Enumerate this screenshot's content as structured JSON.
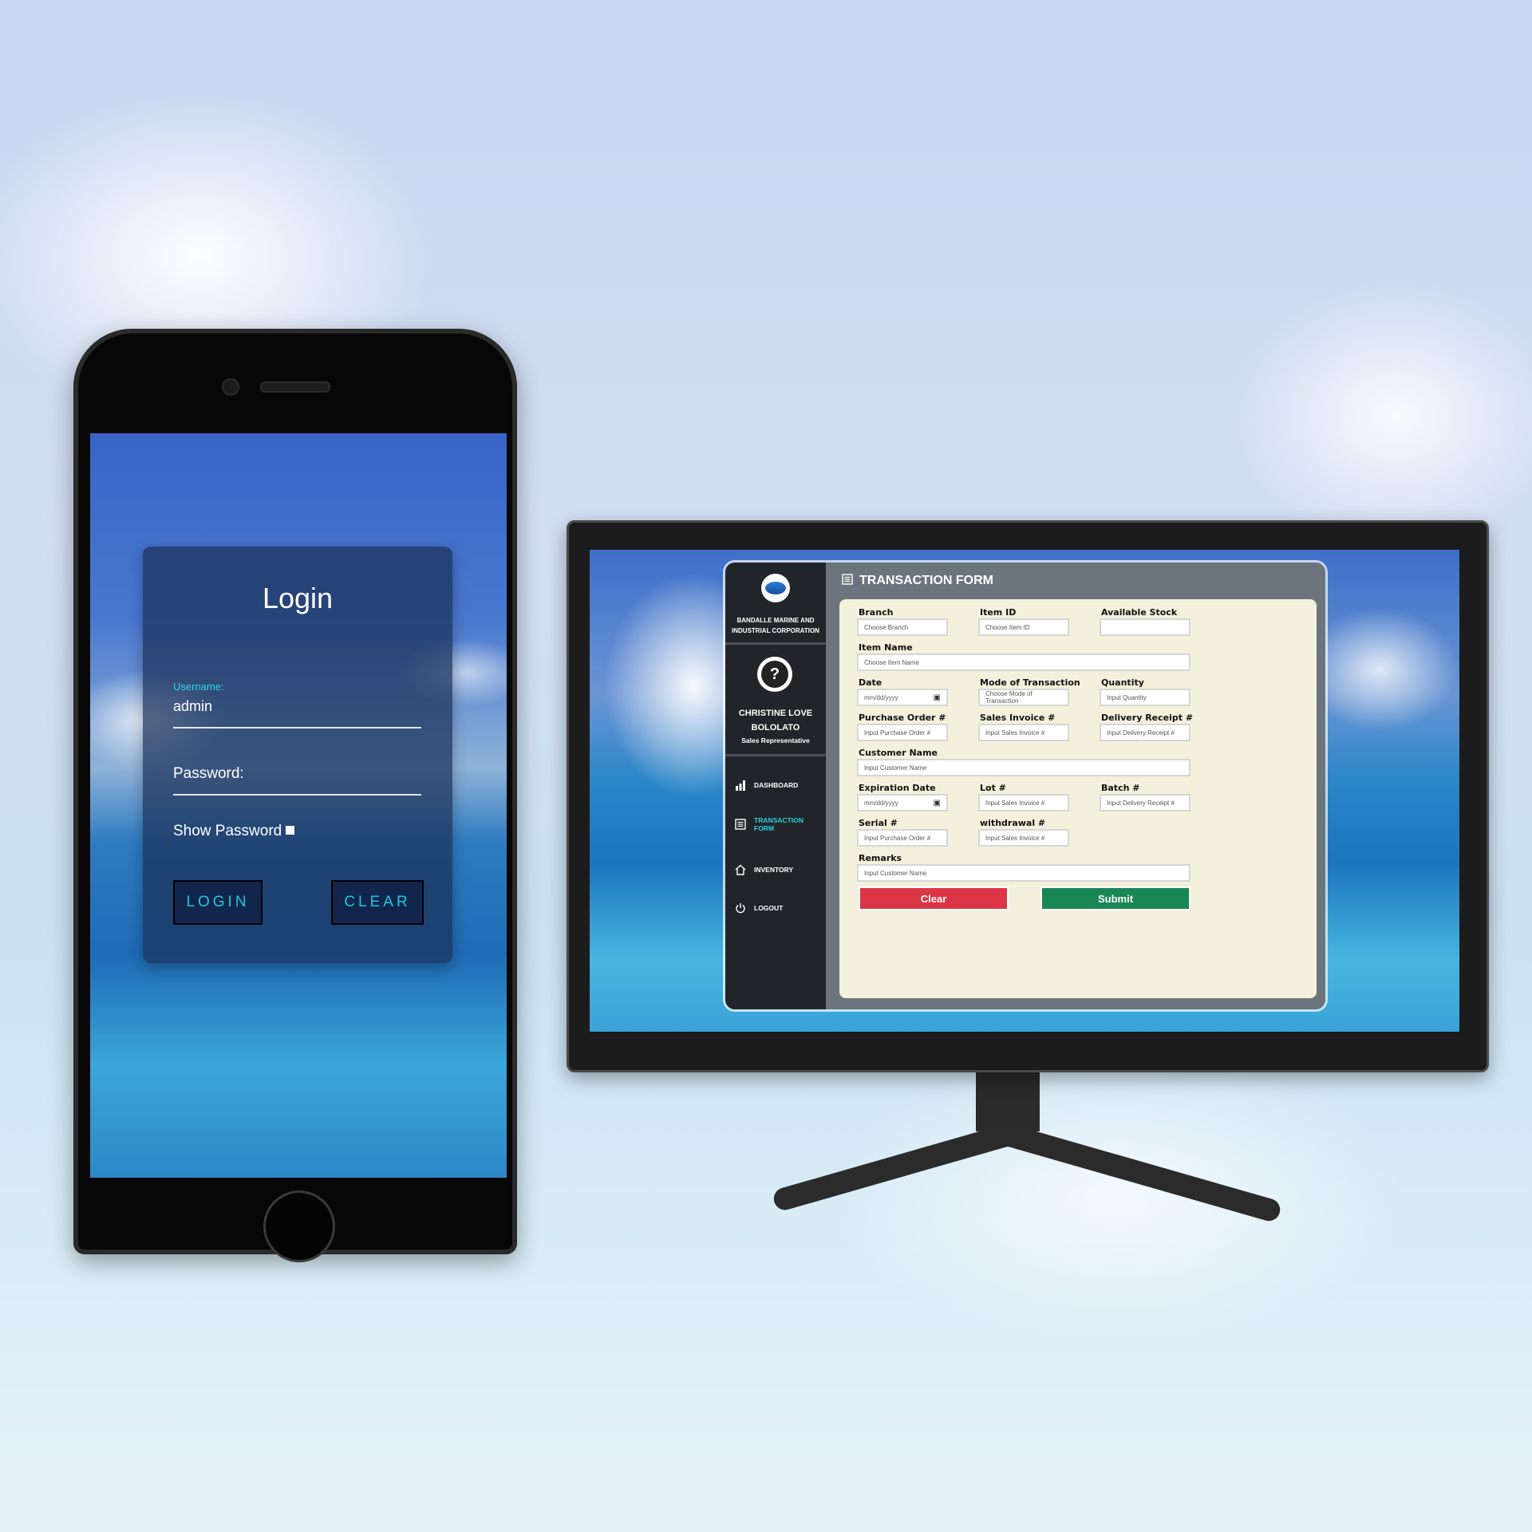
{
  "phone": {
    "login_title": "Login",
    "username_label": "Username:",
    "username_value": "admin",
    "password_label": "Password:",
    "show_password_label": "Show Password",
    "login_button": "LOGIN",
    "clear_button": "CLEAR"
  },
  "desktop": {
    "company_name": "BANDALLE MARINE AND INDUSTRIAL CORPORATION",
    "user": {
      "name": "CHRISTINE LOVE BOLOLATO",
      "role": "Sales Representative"
    },
    "nav": [
      {
        "label": "DASHBOARD",
        "icon": "bar-chart-icon"
      },
      {
        "label": "TRANSACTION FORM",
        "icon": "form-icon",
        "active": true
      },
      {
        "label": "INVENTORY",
        "icon": "home-icon"
      },
      {
        "label": "LOGOUT",
        "icon": "power-icon"
      }
    ],
    "title": "TRANSACTION FORM",
    "fields": {
      "branch": {
        "label": "Branch",
        "placeholder": "Choose Branch"
      },
      "item_id": {
        "label": "Item ID",
        "placeholder": "Choose Item ID"
      },
      "available_stock": {
        "label": "Available Stock",
        "placeholder": ""
      },
      "item_name": {
        "label": "Item Name",
        "placeholder": "Choose Item Name"
      },
      "date": {
        "label": "Date",
        "placeholder": "mm/dd/yyyy"
      },
      "mode": {
        "label": "Mode of Transaction",
        "placeholder": "Choose Mode of Transaction"
      },
      "quantity": {
        "label": "Quantity",
        "placeholder": "Input Quantity"
      },
      "purchase_order": {
        "label": "Purchase Order #",
        "placeholder": "Input Purchase Order #"
      },
      "sales_invoice": {
        "label": "Sales Invoice #",
        "placeholder": "Input Sales Invoice #"
      },
      "delivery_receipt": {
        "label": "Delivery Receipt #",
        "placeholder": "Input Delivery Receipt #"
      },
      "customer_name": {
        "label": "Customer Name",
        "placeholder": "Input Customer Name"
      },
      "expiration_date": {
        "label": "Expiration Date",
        "placeholder": "mm/dd/yyyy"
      },
      "lot": {
        "label": "Lot #",
        "placeholder": "Input Sales Invoice #"
      },
      "batch": {
        "label": "Batch #",
        "placeholder": "Input Delivery Receipt #"
      },
      "serial": {
        "label": "Serial #",
        "placeholder": "Input Purchase Order #"
      },
      "withdrawal": {
        "label": "withdrawal #",
        "placeholder": "Input Sales Invoice #"
      },
      "remarks": {
        "label": "Remarks",
        "placeholder": "Input Customer Name"
      }
    },
    "clear_button": "Clear",
    "submit_button": "Submit"
  },
  "colors": {
    "accent_cyan": "#20c8e0",
    "sidebar_bg": "#212529",
    "form_bg": "#f3f1dc",
    "clear_red": "#dc3545",
    "submit_green": "#198754"
  }
}
